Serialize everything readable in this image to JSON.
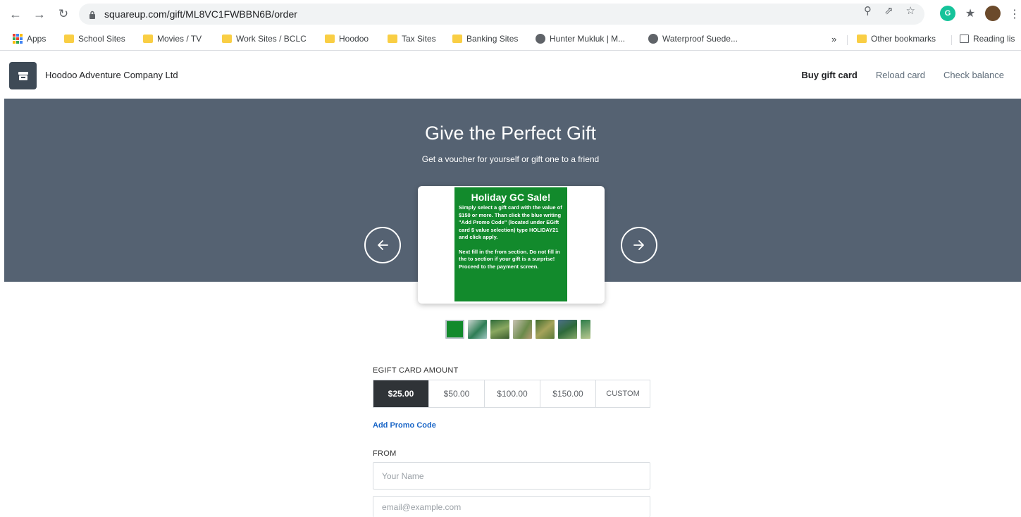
{
  "browser": {
    "url": "squareup.com/gift/ML8VC1FWBBN6B/order"
  },
  "bookmarks": {
    "items": [
      {
        "label": "Apps",
        "kind": "apps"
      },
      {
        "label": "School Sites",
        "kind": "folder"
      },
      {
        "label": "Movies / TV",
        "kind": "folder"
      },
      {
        "label": "Work Sites / BCLC",
        "kind": "folder"
      },
      {
        "label": "Hoodoo",
        "kind": "folder"
      },
      {
        "label": "Tax Sites",
        "kind": "folder"
      },
      {
        "label": "Banking Sites",
        "kind": "folder"
      },
      {
        "label": "Hunter Mukluk | M...",
        "kind": "globe"
      },
      {
        "label": "Waterproof Suede...",
        "kind": "globe"
      }
    ],
    "overflow": "»",
    "other": "Other bookmarks",
    "reading": "Reading lis"
  },
  "site": {
    "store_name": "Hoodoo Adventure Company Ltd",
    "nav": {
      "buy": "Buy gift card",
      "reload": "Reload card",
      "balance": "Check balance"
    }
  },
  "hero": {
    "title": "Give the Perfect Gift",
    "subtitle": "Get a voucher for yourself or gift one to a friend",
    "card": {
      "heading": "Holiday GC Sale!",
      "paragraph1": "Simply select a gift card with the value of $150 or more. Than click the blue writing \"Add Promo Code\" (located under EGift card $ value selection) type HOLIDAY21 and click apply.",
      "paragraph2": "Next fill in the from section. Do not fill in the to section if your gift is a surprise! Proceed to the payment screen."
    }
  },
  "form": {
    "amount_label": "EGIFT CARD AMOUNT",
    "amounts": [
      "$25.00",
      "$50.00",
      "$100.00",
      "$150.00",
      "CUSTOM"
    ],
    "selected_amount": "$25.00",
    "promo_link": "Add Promo Code",
    "from_label": "FROM",
    "name_placeholder": "Your Name",
    "email_placeholder": "email@example.com"
  },
  "colors": {
    "hero_bg": "#556272",
    "card_green": "#128a2c",
    "selected_amount_bg": "#2f3337",
    "link_blue": "#1a66c7"
  }
}
